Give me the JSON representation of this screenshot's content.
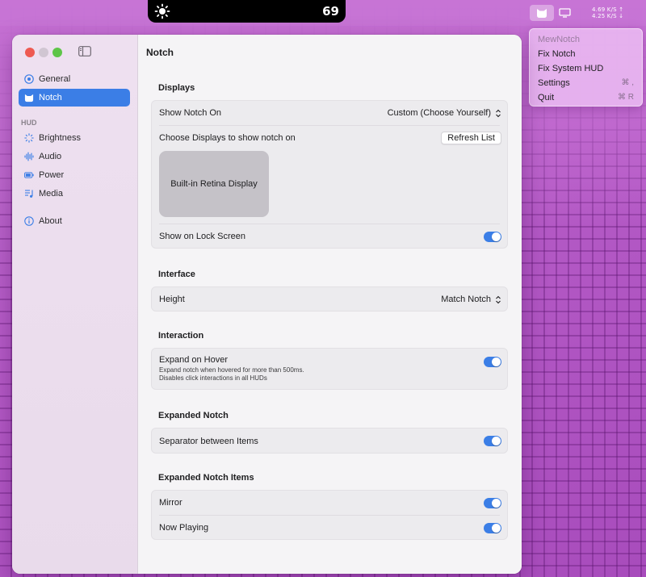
{
  "menubar": {
    "notch_hud_value": "69",
    "net_up": "4.69 K/S ↑",
    "net_down": "4.25 K/S ↓"
  },
  "menu": {
    "app_name": "MewNotch",
    "items": [
      {
        "label": "Fix Notch",
        "shortcut": ""
      },
      {
        "label": "Fix System HUD",
        "shortcut": ""
      },
      {
        "label": "Settings",
        "shortcut": "⌘ ,"
      },
      {
        "label": "Quit",
        "shortcut": "⌘ R"
      }
    ]
  },
  "sidebar": {
    "items_top": [
      {
        "label": "General",
        "icon": "gear-circle-icon"
      },
      {
        "label": "Notch",
        "icon": "cat-icon"
      }
    ],
    "section_hud": "HUD",
    "items_hud": [
      {
        "label": "Brightness",
        "icon": "brightness-icon"
      },
      {
        "label": "Audio",
        "icon": "waveform-icon"
      },
      {
        "label": "Power",
        "icon": "battery-icon"
      },
      {
        "label": "Media",
        "icon": "music-list-icon"
      }
    ],
    "about": {
      "label": "About",
      "icon": "info-icon"
    },
    "selected": "Notch"
  },
  "content": {
    "title": "Notch",
    "displays": {
      "title": "Displays",
      "show_notch_on_label": "Show Notch On",
      "show_notch_on_value": "Custom (Choose Yourself)",
      "choose_displays_label": "Choose Displays to show notch on",
      "refresh_button": "Refresh List",
      "display_tile": "Built-in Retina Display",
      "lock_screen_label": "Show on Lock Screen",
      "lock_screen_on": true
    },
    "interface": {
      "title": "Interface",
      "height_label": "Height",
      "height_value": "Match Notch"
    },
    "interaction": {
      "title": "Interaction",
      "expand_hover_label": "Expand on Hover",
      "expand_hover_sub1": "Expand notch when hovered for more than 500ms.",
      "expand_hover_sub2": "Disables click interactions in all HUDs",
      "expand_hover_on": true
    },
    "expanded": {
      "title": "Expanded Notch",
      "separator_label": "Separator between Items",
      "separator_on": true
    },
    "expanded_items": {
      "title": "Expanded Notch Items",
      "mirror_label": "Mirror",
      "mirror_on": true,
      "now_playing_label": "Now Playing",
      "now_playing_on": true
    }
  },
  "colors": {
    "accent": "#3b7ee6",
    "wallpaper": "#b35fc4"
  }
}
